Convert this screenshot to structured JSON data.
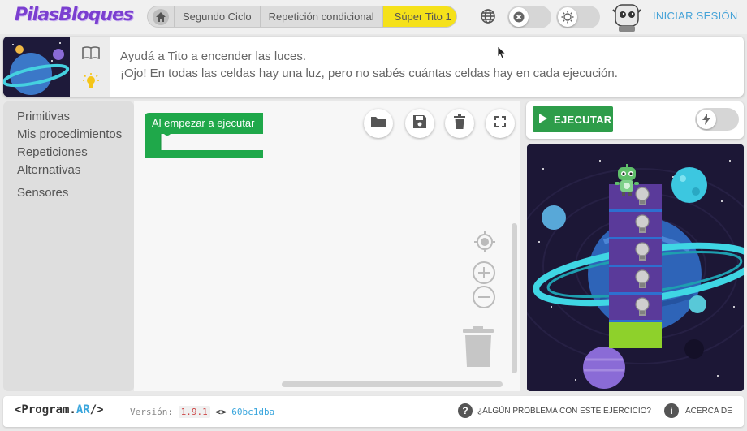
{
  "header": {
    "logo": "PilasBloques",
    "breadcrumbs": [
      "Segundo Ciclo",
      "Repetición condicional",
      "Súper Tito 1"
    ],
    "login": "INICIAR SESIÓN"
  },
  "instructions": {
    "line1": "Ayudá a Tito a encender las luces.",
    "line2": "¡Ojo! En todas las celdas hay una luz, pero no sabés cuántas celdas hay en cada ejecución."
  },
  "toolbox": {
    "categories": [
      "Primitivas",
      "Mis procedimientos",
      "Repeticiones",
      "Alternativas",
      "Sensores"
    ]
  },
  "workspace": {
    "start_block": "Al empezar a ejecutar",
    "buttons": [
      "folder-icon",
      "save-icon",
      "trash-icon",
      "fullscreen-icon"
    ]
  },
  "runbar": {
    "run_label": "EJECUTAR"
  },
  "scene": {
    "cells": 5
  },
  "footer": {
    "brand_left": "<Program.",
    "brand_ar": "AR",
    "brand_right": "/>",
    "version_label": "Versión:",
    "version": "1.9.1",
    "code_icon": "<>",
    "hash": "60bc1dba",
    "help": "¿ALGÚN PROBLEMA CON ESTE EJERCICIO?",
    "about": "ACERCA DE"
  },
  "colors": {
    "accent_green": "#2e9d4a",
    "block_green": "#1fa84a",
    "crumb_active": "#f5e11a",
    "link_blue": "#46a3d8",
    "cell_purple": "#5a3a9a",
    "cell_green": "#8ed12b"
  }
}
